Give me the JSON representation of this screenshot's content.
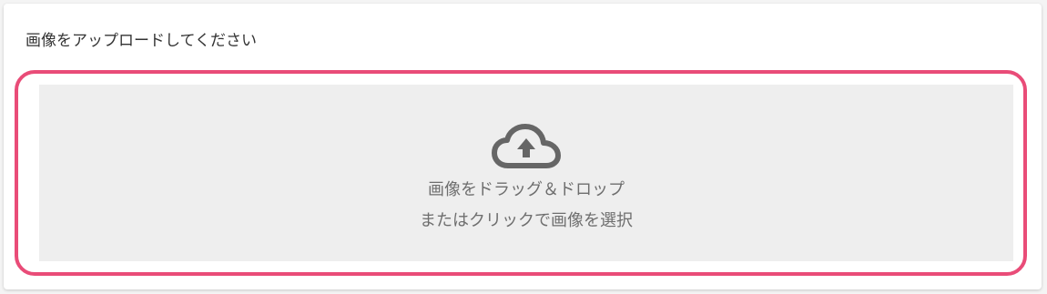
{
  "card": {
    "title": "画像をアップロードしてください"
  },
  "dropzone": {
    "icon": "cloud-upload-icon",
    "line1": "画像をドラッグ＆ドロップ",
    "line2": "またはクリックで画像を選択",
    "highlight_color": "#e94c78",
    "background_color": "#eeeeee"
  }
}
